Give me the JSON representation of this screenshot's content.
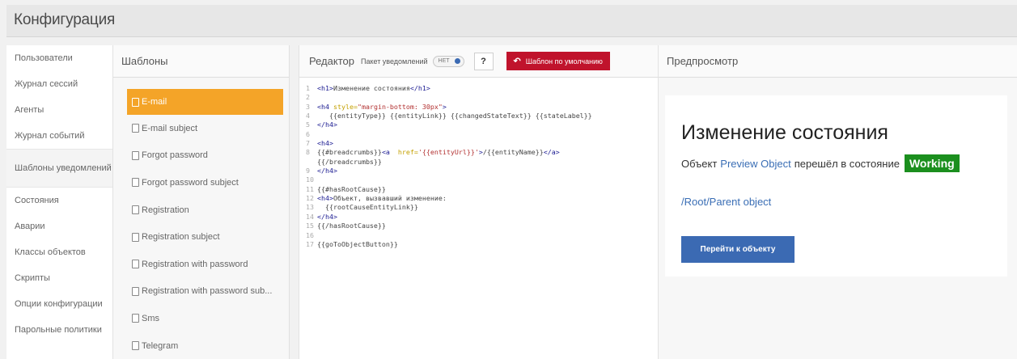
{
  "header": {
    "title": "Конфигурация"
  },
  "nav": {
    "items": [
      {
        "label": "Пользователи"
      },
      {
        "label": "Журнал сессий"
      },
      {
        "label": "Агенты"
      },
      {
        "label": "Журнал событий"
      },
      {
        "label": "Шаблоны уведомлений",
        "active": true
      },
      {
        "label": "Состояния"
      },
      {
        "label": "Аварии"
      },
      {
        "label": "Классы объектов"
      },
      {
        "label": "Скрипты"
      },
      {
        "label": "Опции конфигурации"
      },
      {
        "label": "Парольные политики"
      }
    ]
  },
  "templates": {
    "heading": "Шаблоны",
    "items": [
      {
        "label": "E-mail",
        "active": true
      },
      {
        "label": "E-mail subject"
      },
      {
        "label": "Forgot password"
      },
      {
        "label": "Forgot password subject"
      },
      {
        "label": "Registration"
      },
      {
        "label": "Registration subject"
      },
      {
        "label": "Registration with password"
      },
      {
        "label": "Registration with password sub..."
      },
      {
        "label": "Sms"
      },
      {
        "label": "Telegram"
      }
    ]
  },
  "editor": {
    "heading": "Редактор",
    "package_label": "Пакет уведомлений",
    "toggle_value": "НЕТ",
    "help_label": "?",
    "default_button_label": "Шаблон по умолчанию",
    "code_lines": [
      {
        "n": "1",
        "segs": [
          [
            "tag",
            "<h1>"
          ],
          [
            "txt",
            "Изменение состояния"
          ],
          [
            "tag",
            "</h1>"
          ]
        ]
      },
      {
        "n": "2",
        "segs": []
      },
      {
        "n": "3",
        "segs": [
          [
            "tag",
            "<h4 "
          ],
          [
            "attr",
            "style="
          ],
          [
            "str",
            "\"margin-bottom: 30px\""
          ],
          [
            "tag",
            ">"
          ]
        ]
      },
      {
        "n": "4",
        "segs": [
          [
            "txt",
            "   {{entityType}} {{entityLink}} {{changedStateText}} {{stateLabel}}"
          ]
        ]
      },
      {
        "n": "5",
        "segs": [
          [
            "tag",
            "</h4>"
          ]
        ]
      },
      {
        "n": "6",
        "segs": []
      },
      {
        "n": "7",
        "segs": [
          [
            "tag",
            "<h4>"
          ]
        ]
      },
      {
        "n": "8",
        "segs": [
          [
            "txt",
            "{{#breadcrumbs}}"
          ],
          [
            "tag",
            "<a  "
          ],
          [
            "attr",
            "href="
          ],
          [
            "str",
            "'{{entityUrl}}'"
          ],
          [
            "tag",
            ">"
          ],
          [
            "txt",
            "/{{entityName}}"
          ],
          [
            "tag",
            "</a>"
          ]
        ]
      },
      {
        "n": "",
        "segs": [
          [
            "txt",
            "{{/breadcrumbs}}"
          ]
        ]
      },
      {
        "n": "9",
        "segs": [
          [
            "tag",
            "</h4>"
          ]
        ]
      },
      {
        "n": "10",
        "segs": []
      },
      {
        "n": "11",
        "segs": [
          [
            "txt",
            "{{#hasRootCause}}"
          ]
        ]
      },
      {
        "n": "12",
        "segs": [
          [
            "tag",
            "<h4>"
          ],
          [
            "txt",
            "Объект, вызвавший изменение:"
          ]
        ]
      },
      {
        "n": "13",
        "segs": [
          [
            "txt",
            "  {{rootCauseEntityLink}}"
          ]
        ]
      },
      {
        "n": "14",
        "segs": [
          [
            "tag",
            "</h4>"
          ]
        ]
      },
      {
        "n": "15",
        "segs": [
          [
            "txt",
            "{{/hasRootCause}}"
          ]
        ]
      },
      {
        "n": "16",
        "segs": []
      },
      {
        "n": "17",
        "segs": [
          [
            "txt",
            "{{goToObjectButton}}"
          ]
        ]
      }
    ]
  },
  "preview": {
    "heading": "Предпросмотр",
    "title": "Изменение состояния",
    "object_label": "Объект",
    "object_link": "Preview Object",
    "changed_text": "перешёл в состояние",
    "state_label": "Working",
    "breadcrumb": "/Root/Parent object",
    "goto_button": "Перейти к объекту"
  },
  "colors": {
    "accent": "#f4a428",
    "danger": "#c0132c",
    "primary": "#3b6ab3",
    "success": "#1b8f1e",
    "link": "#3a6eb5"
  }
}
